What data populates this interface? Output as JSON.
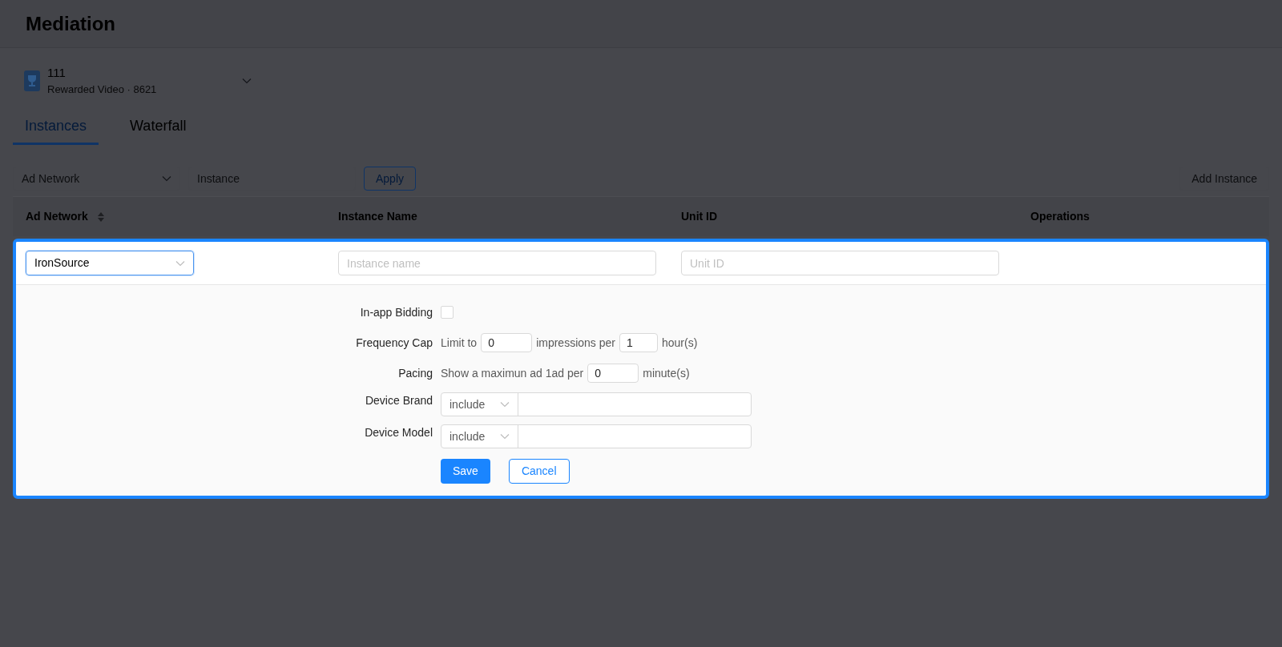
{
  "page_title": "Mediation",
  "app_selector": {
    "name": "111",
    "subtitle": "Rewarded Video · 8621"
  },
  "tabs": [
    {
      "label": "Instances",
      "selected": true
    },
    {
      "label": "Waterfall",
      "selected": false
    }
  ],
  "filters": {
    "ad_network": {
      "placeholder": "Ad Network"
    },
    "instance": {
      "placeholder": "Instance"
    },
    "apply": "Apply",
    "add": "Add Instance"
  },
  "table": {
    "columns": [
      {
        "label": "Ad Network",
        "sortable": true
      },
      {
        "label": "Instance Name",
        "sortable": false
      },
      {
        "label": "Unit ID",
        "sortable": false
      },
      {
        "label": "Operations",
        "sortable": false
      }
    ]
  },
  "edit_row": {
    "ad_network": "IronSource",
    "instance_name": {
      "placeholder": "Instance name"
    },
    "unit_id": {
      "placeholder": "Unit ID"
    }
  },
  "form": {
    "in_app_bidding": {
      "label": "In-app Bidding",
      "checked": false
    },
    "frequency_cap": {
      "label": "Frequency Cap",
      "prefix": "Limit to",
      "impressions": "0",
      "middle": "impressions per",
      "hours": "1",
      "suffix": "hour(s)"
    },
    "pacing": {
      "label": "Pacing",
      "prefix": "Show a maximun ad 1ad per",
      "minutes": "0",
      "suffix": "minute(s)"
    },
    "targets": [
      {
        "label": "Device Brand",
        "mode": "include"
      },
      {
        "label": "Device Model",
        "mode": "include"
      }
    ],
    "save": "Save",
    "cancel": "Cancel"
  }
}
